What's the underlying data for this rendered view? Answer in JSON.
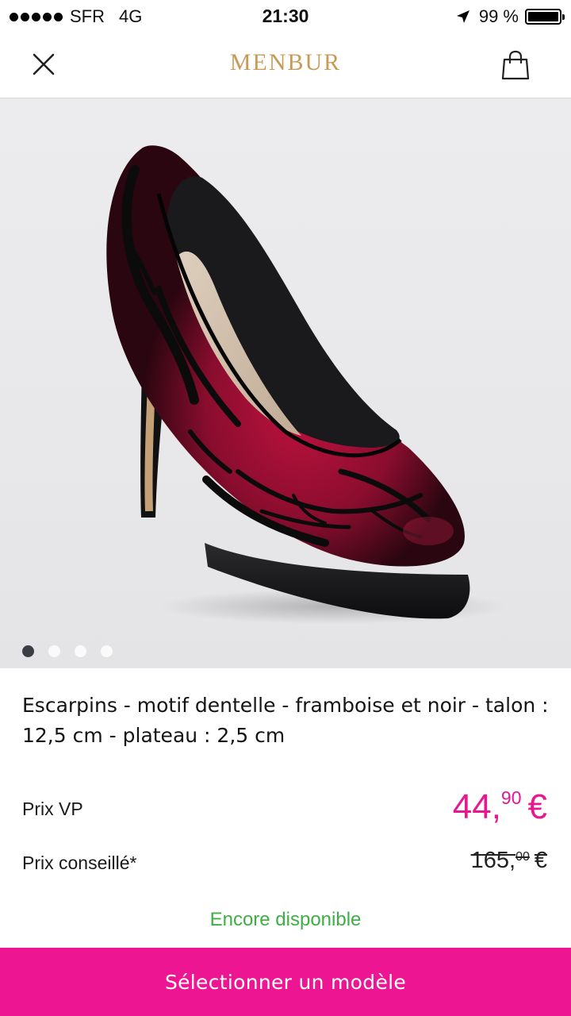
{
  "status_bar": {
    "carrier": "SFR",
    "network": "4G",
    "time": "21:30",
    "battery": "99 %",
    "battery_level": 0.99,
    "icons": [
      "signal-dots",
      "location-arrow-icon",
      "battery-icon"
    ]
  },
  "header": {
    "brand": "MENBUR",
    "brand_color": "#c79a56",
    "icons": {
      "close": "close-icon",
      "bag": "shopping-bag-icon"
    }
  },
  "product": {
    "title": "Escarpins - motif dentelle - framboise et noir - talon : 12,5 cm - plateau : 2,5 cm",
    "image_count": 4,
    "active_image": 1
  },
  "pricing": {
    "vp_label": "Prix VP",
    "vp_price_int": "44,",
    "vp_price_dec": "90",
    "vp_currency": "€",
    "rrp_label": "Prix conseillé*",
    "rrp_price_int": "165,",
    "rrp_price_dec": "00",
    "rrp_currency": "€",
    "accent_color": "#e5188f"
  },
  "availability": {
    "text": "Encore disponible",
    "color": "#3fae45"
  },
  "cta": {
    "label": "Sélectionner un modèle",
    "color": "#ee1593"
  }
}
